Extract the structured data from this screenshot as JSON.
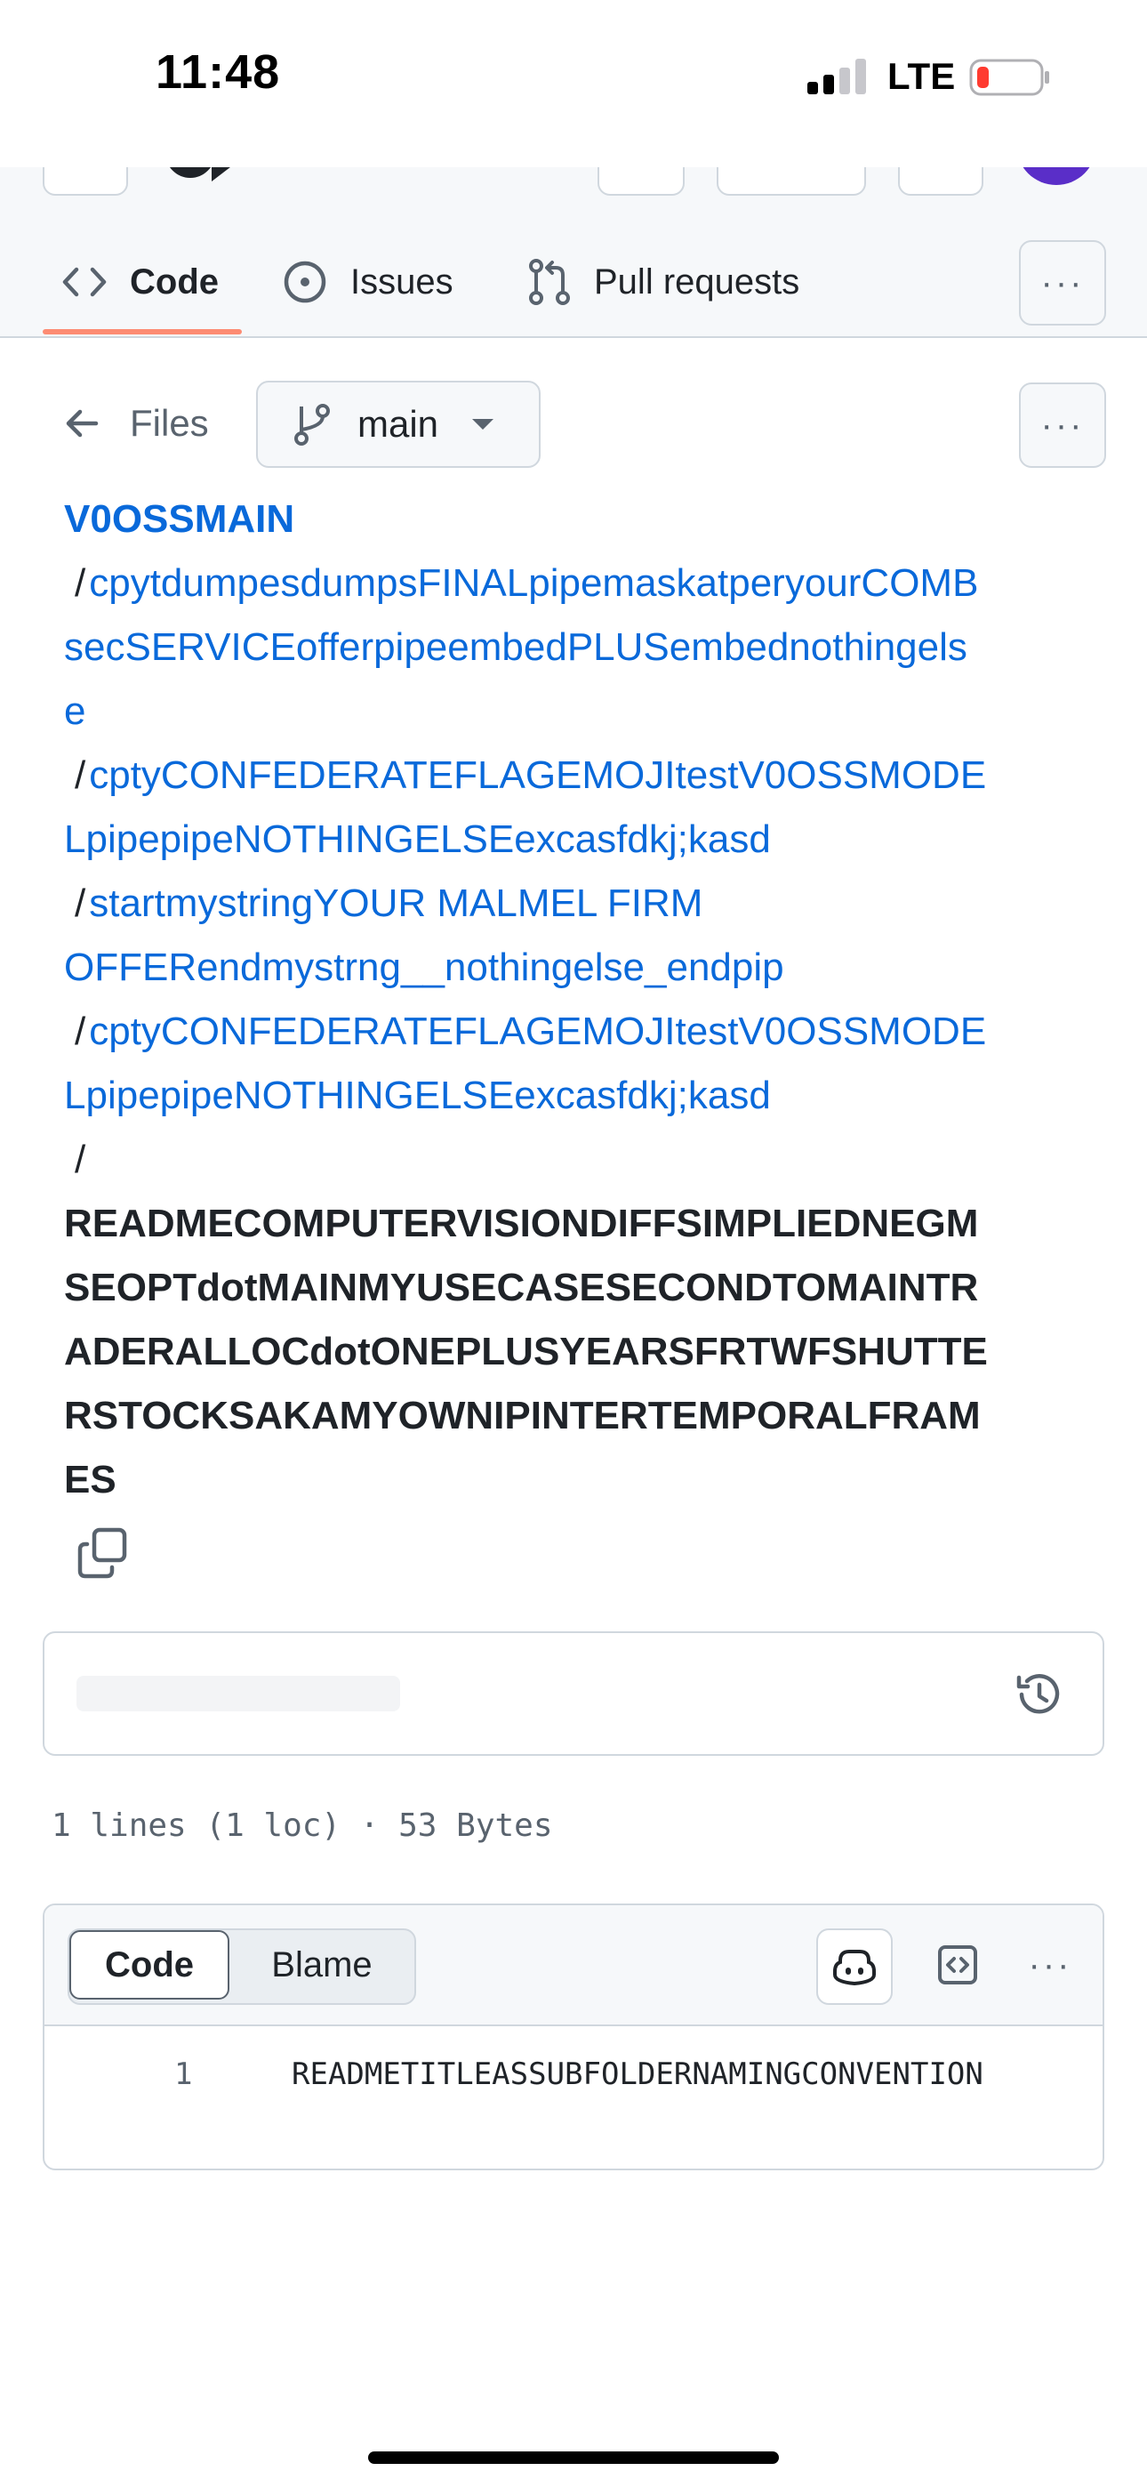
{
  "status_bar": {
    "time": "11:48",
    "network": "LTE"
  },
  "repo_header": {
    "repo_name_clipped": "V0OSSMAIN",
    "tabs": [
      {
        "label": "Code",
        "icon": "code-icon",
        "active": true
      },
      {
        "label": "Issues",
        "icon": "issue-opened-icon",
        "active": false
      },
      {
        "label": "Pull requests",
        "icon": "git-pull-request-icon",
        "active": false
      }
    ],
    "more_label": "···",
    "active_tab_color": "#fd8c73"
  },
  "files_nav": {
    "files_label": "Files",
    "branch": "main",
    "more_label": "···"
  },
  "breadcrumb": {
    "root": "V0OSSMAIN",
    "separator": "/",
    "segments": [
      "cpytdumpesdumpsFINALpipemaskatperyourCOMBsecSERVICEofferpipeembedPLUSembednothingelse",
      "cptyCONFEDERATEFLAGEMOJItestV0OSSMODELpipepipeNOTHINGELSEexcasfdkj;kasd",
      "startmystringYOUR MALMEL FIRM OFFERendmystrng__nothingelse_endpip",
      "cptyCONFEDERATEFLAGEMOJItestV0OSSMODELpipepipeNOTHINGELSEexcasfdkj;kasd"
    ],
    "file": "READMECOMPUTERVISIONDIFFSIMPLIEDNEGMSEOPTdotMAINMYUSECASESECONDTOMAINTRADERALLOCdotONEPLUSYEARSFRTWFSHUTTERSTOCKSAKAMYOWNIPINTERTEMPORALFRAMES"
  },
  "file_meta": "1 lines (1 loc) · 53 Bytes",
  "code_view": {
    "tab_code": "Code",
    "tab_blame": "Blame",
    "more_label": "···",
    "lines": [
      {
        "number": "1",
        "text": "READMETITLEASSUBFOLDERNAMINGCONVENTION"
      }
    ]
  }
}
